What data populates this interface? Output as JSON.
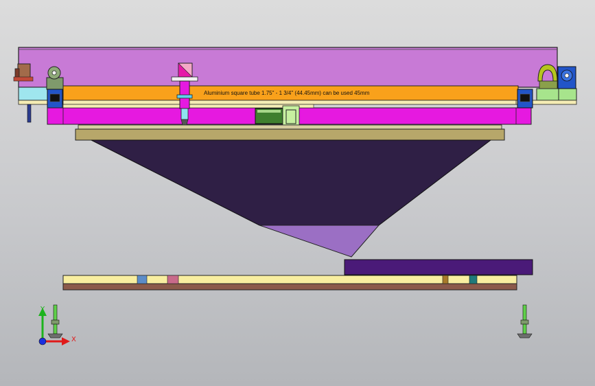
{
  "view": {
    "annotation": "Aluminium square tube 1.75\" - 1 3/4\" (44.45mm) can be used 45mm",
    "triad": {
      "y_label": "Y",
      "x_label": "X"
    }
  },
  "colors": {
    "background": "#c8c9cc",
    "top_plate": "#c87ad6",
    "tube": "#f9a11b",
    "magenta_bar": "#e619e0",
    "hopper": "#2f1f45",
    "hopper_tip": "#9b6fc4",
    "base_plate": "#b7a76a",
    "rail": "#f8eea0",
    "rail_bottom": "#8b5a4a",
    "bed_block": "#4a1a78",
    "bracket_blue": "#2255c8",
    "bracket_green": "#7f9a6c"
  }
}
